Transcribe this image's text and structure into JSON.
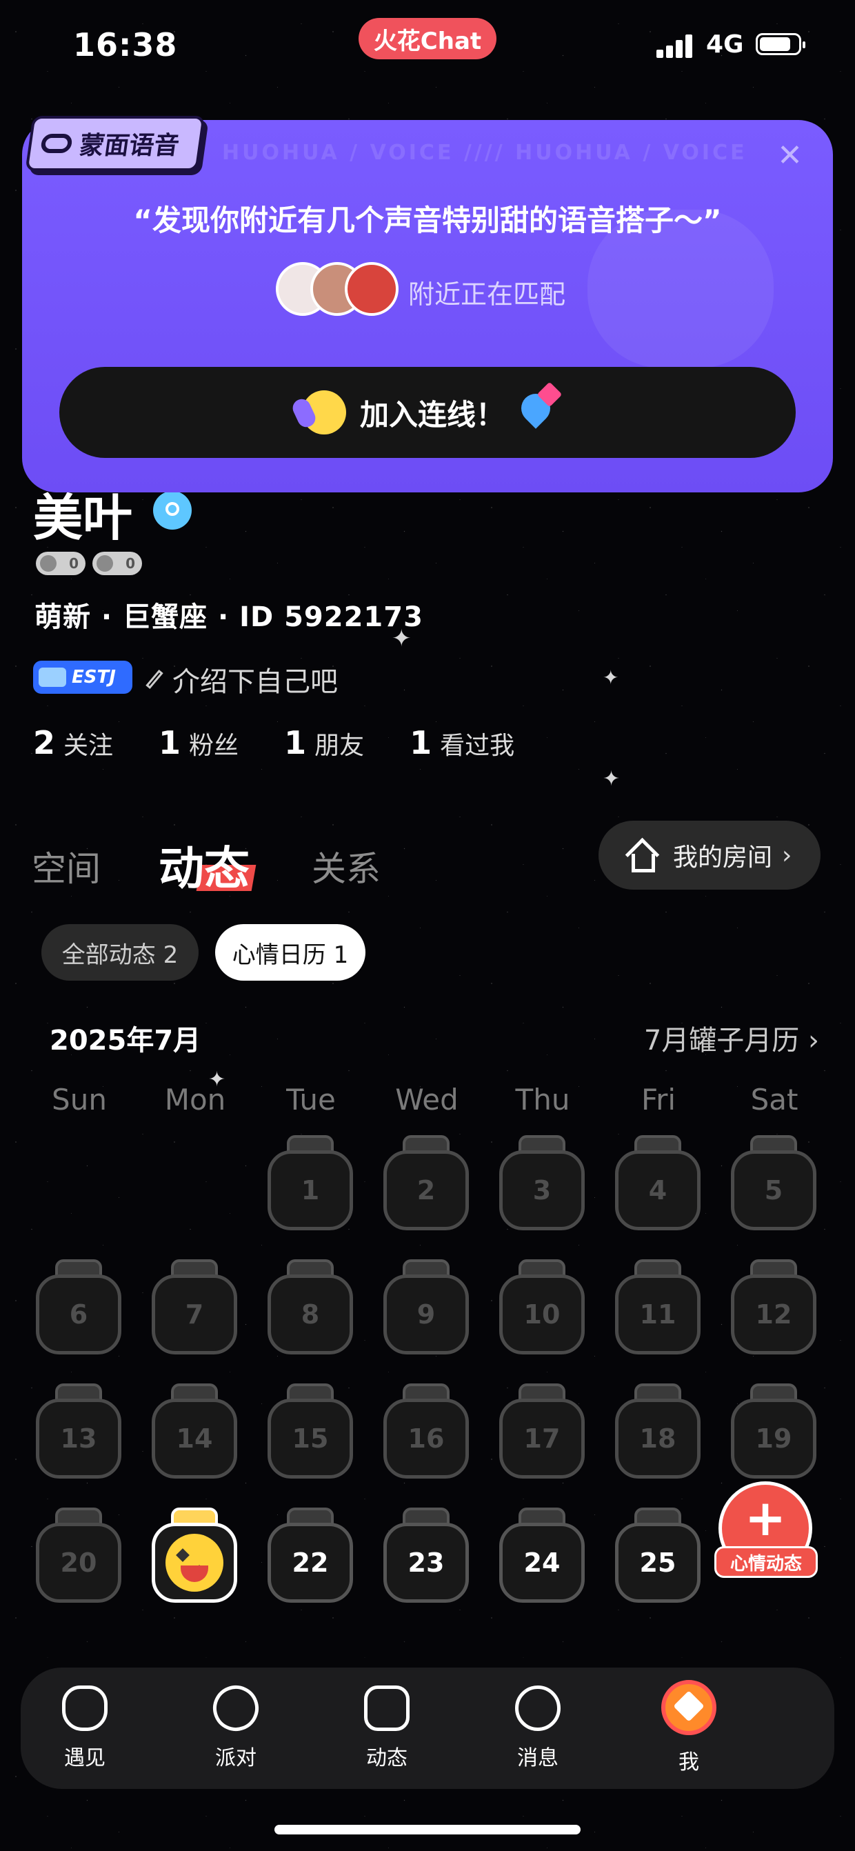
{
  "status_bar": {
    "time": "16:38",
    "app_name": "火花Chat",
    "network": "4G"
  },
  "banner": {
    "tag": "蒙面语音",
    "background_text": "HUOHUA / VOICE //// HUOHUA / VOICE",
    "quote": "“发现你附近有几个声音特别甜的语音搭子～”",
    "matching_text": "附近正在匹配",
    "join_label": "加入连线！",
    "close_icon": "close-icon",
    "accent": "#6d4df5"
  },
  "profile": {
    "name": "美叶",
    "badges": [
      "0",
      "0"
    ],
    "meta": "萌新 · 巨蟹座 · ID 5922173",
    "mbti": "ESTJ",
    "intro": "介绍下自己吧",
    "stats": [
      {
        "count": "2",
        "label": "关注"
      },
      {
        "count": "1",
        "label": "粉丝"
      },
      {
        "count": "1",
        "label": "朋友"
      },
      {
        "count": "1",
        "label": "看过我"
      }
    ]
  },
  "tabs": [
    "空间",
    "动态",
    "关系"
  ],
  "active_tab": "动态",
  "room_button": "我的房间",
  "filters": {
    "all": "全部动态 2",
    "mood": "心情日历 1"
  },
  "calendar": {
    "month": "2025年7月",
    "month_link": "7月罐子月历",
    "weekdays": [
      "Sun",
      "Mon",
      "Tue",
      "Wed",
      "Thu",
      "Fri",
      "Sat"
    ],
    "days": [
      "1",
      "2",
      "3",
      "4",
      "5",
      "6",
      "7",
      "8",
      "9",
      "10",
      "11",
      "12",
      "13",
      "14",
      "15",
      "16",
      "17",
      "18",
      "19",
      "20",
      "21",
      "22",
      "23",
      "24",
      "25"
    ],
    "filled_day": "21",
    "filled_icon": "happy-face-icon",
    "future_days": [
      "22",
      "23",
      "24",
      "25"
    ]
  },
  "fab": {
    "label": "心情动态",
    "color": "#f0524a"
  },
  "nav": [
    {
      "label": "遇见",
      "icon": "meet-icon"
    },
    {
      "label": "派对",
      "icon": "planet-icon"
    },
    {
      "label": "动态",
      "icon": "flower-icon"
    },
    {
      "label": "消息",
      "icon": "chat-bubble-icon"
    },
    {
      "label": "我",
      "icon": "me-icon"
    }
  ]
}
